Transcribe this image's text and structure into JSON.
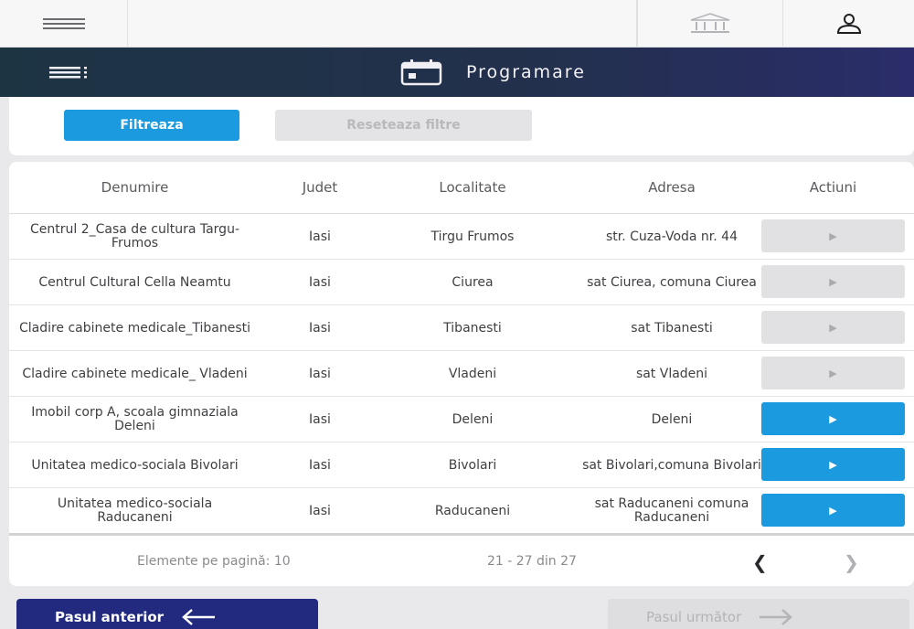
{
  "topbar": {
    "menu_icon": "hamburger-icon",
    "bank_icon": "bank-building-icon",
    "user_icon": "user-icon"
  },
  "header": {
    "menu_icon": "list-menu-icon",
    "calendar_icon": "calendar-icon",
    "title": "Programare"
  },
  "filters": {
    "filter_label": "Filtreaza",
    "reset_label": "Reseteaza filtre"
  },
  "table": {
    "columns": [
      "Denumire",
      "Judet",
      "Localitate",
      "Adresa",
      "Actiuni"
    ],
    "rows": [
      {
        "denumire": "Centrul 2_Casa de cultura Targu-Frumos",
        "judet": "Iasi",
        "localitate": "Tirgu Frumos",
        "adresa": "str. Cuza-Voda nr. 44",
        "action_icon": "play-icon",
        "action_enabled": false
      },
      {
        "denumire": "Centrul Cultural Cella Neamtu",
        "judet": "Iasi",
        "localitate": "Ciurea",
        "adresa": "sat Ciurea, comuna Ciurea",
        "action_icon": "play-icon",
        "action_enabled": false
      },
      {
        "denumire": "Cladire cabinete medicale_Tibanesti",
        "judet": "Iasi",
        "localitate": "Tibanesti",
        "adresa": "sat Tibanesti",
        "action_icon": "play-icon",
        "action_enabled": false
      },
      {
        "denumire": "Cladire cabinete medicale_ Vladeni",
        "judet": "Iasi",
        "localitate": "Vladeni",
        "adresa": "sat Vladeni",
        "action_icon": "play-icon",
        "action_enabled": false
      },
      {
        "denumire": "Imobil corp A, scoala gimnaziala Deleni",
        "judet": "Iasi",
        "localitate": "Deleni",
        "adresa": "Deleni",
        "action_icon": "play-icon",
        "action_enabled": true
      },
      {
        "denumire": "Unitatea medico-sociala Bivolari",
        "judet": "Iasi",
        "localitate": "Bivolari",
        "adresa": "sat Bivolari,comuna Bivolari",
        "action_icon": "play-icon",
        "action_enabled": true
      },
      {
        "denumire": "Unitatea medico-sociala Raducaneni",
        "judet": "Iasi",
        "localitate": "Raducaneni",
        "adresa": "sat Raducaneni comuna Raducaneni",
        "action_icon": "play-icon",
        "action_enabled": true
      }
    ]
  },
  "pagination": {
    "per_page_label": "Elemente pe pagină: 10",
    "range": "21 - 27 din 27",
    "prev_icon": "chevron-left-icon",
    "next_icon": "chevron-right-icon"
  },
  "nav": {
    "back_label": "Pasul anterior",
    "next_label": "Pasul următor",
    "back_icon": "arrow-left-icon",
    "next_icon": "arrow-right-icon"
  },
  "colors": {
    "accent": "#1b9ae0",
    "primary_dark": "#212a7e",
    "band_start": "#1d3443",
    "band_end": "#2a2d6a"
  }
}
